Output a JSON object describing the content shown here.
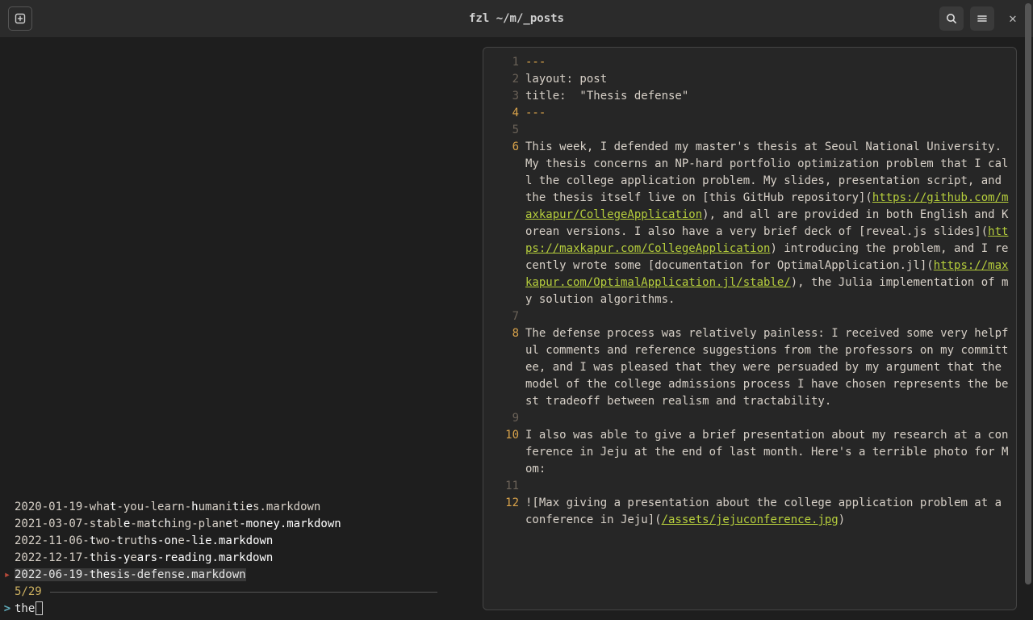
{
  "title": "fzl ~/m/_posts",
  "files": [
    {
      "name": "2020-01-19-what-you-learn-humanities.markdown",
      "selected": false,
      "chunks": [
        "2020-01-19-wha",
        "t",
        "-you-learn-",
        "h",
        "umani",
        "t",
        "i",
        "e",
        "s.markdown"
      ]
    },
    {
      "name": "2021-03-07-stable-matching-planet-money.markdown",
      "selected": false,
      "chunks": [
        "2021-03-07-s",
        "t",
        "abl",
        "e",
        "-ma",
        "t",
        "c",
        "h",
        "ing-plan",
        "e",
        "t",
        "-money.markdown"
      ]
    },
    {
      "name": "2022-11-06-two-truths-one-lie.markdown",
      "selected": false,
      "chunks": [
        "2022-11-06-",
        "t",
        "wo-",
        "t",
        "ru",
        "t",
        "h",
        "s-on",
        "e",
        "-lie.markdown"
      ]
    },
    {
      "name": "2022-12-17-this-years-reading.markdown",
      "selected": false,
      "chunks": [
        "2022-12-17-",
        "t",
        "h",
        "is-y",
        "e",
        "ars-reading.markdown"
      ]
    },
    {
      "name": "2022-06-19-thesis-defense.markdown",
      "selected": true,
      "chunks": [
        "2022-06-19-",
        "the",
        "sis-defense.markdown"
      ]
    }
  ],
  "counter": "5/29",
  "query": "the",
  "code_lines": [
    {
      "n": 1,
      "gut_hl": false,
      "html": "<span class=\"fm-dash\">---</span>"
    },
    {
      "n": 2,
      "gut_hl": false,
      "html": "layout: post"
    },
    {
      "n": 3,
      "gut_hl": false,
      "html": "title:  \"Thesis defense\""
    },
    {
      "n": 4,
      "gut_hl": true,
      "html": "<span class=\"fm-dash\">---</span>"
    },
    {
      "n": 5,
      "gut_hl": false,
      "html": ""
    },
    {
      "n": 6,
      "gut_hl": true,
      "html": "This week, I defended my master's thesis at Seoul National University. My thesis concerns an NP-hard portfolio optimization problem that I call the college application problem. My slides, presentation script, and the thesis itself live on [this GitHub repository](<a href=\"#\">https://github.com/maxkapur/CollegeApplication</a>), and all are provided in both English and Korean versions. I also have a very brief deck of [reveal.js slides](<a href=\"#\">https://maxkapur.com/CollegeApplication</a>) introducing the problem, and I recently wrote some [documentation for OptimalApplication.jl](<a href=\"#\">https://maxkapur.com/OptimalApplication.jl/stable/</a>), the Julia implementation of my solution algorithms."
    },
    {
      "n": 7,
      "gut_hl": false,
      "html": ""
    },
    {
      "n": 8,
      "gut_hl": true,
      "html": "The defense process was relatively painless: I received some very helpful comments and reference suggestions from the professors on my committee, and I was pleased that they were persuaded by my argument that the model of the college admissions process I have chosen represents the best tradeoff between realism and tractability."
    },
    {
      "n": 9,
      "gut_hl": false,
      "html": ""
    },
    {
      "n": 10,
      "gut_hl": true,
      "html": "I also was able to give a brief presentation about my research at a conference in Jeju at the end of last month. Here's a terrible photo for Mom:"
    },
    {
      "n": 11,
      "gut_hl": false,
      "html": ""
    },
    {
      "n": 12,
      "gut_hl": true,
      "html": "![Max giving a presentation about the college application problem at a conference in Jeju](<a href=\"#\">/assets/jejuconference.jpg</a>)"
    }
  ]
}
